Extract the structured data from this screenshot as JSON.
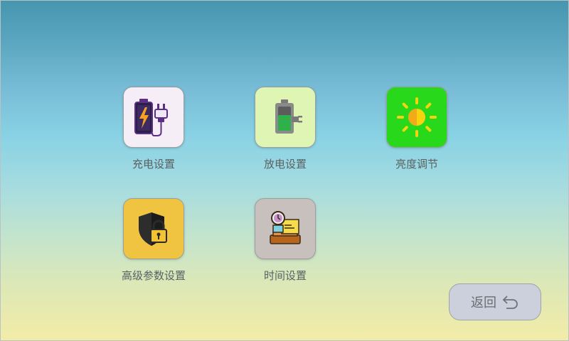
{
  "menu": {
    "items": [
      {
        "label": "充电设置",
        "icon": "battery-charging-plug-icon",
        "color": "#f5eef7"
      },
      {
        "label": "放电设置",
        "icon": "battery-plug-icon",
        "color": "#dff5b3"
      },
      {
        "label": "亮度调节",
        "icon": "sun-icon",
        "color": "#27d81b"
      },
      {
        "label": "高级参数设置",
        "icon": "shield-lock-icon",
        "color": "#f0c341"
      },
      {
        "label": "时间设置",
        "icon": "clock-box-icon",
        "color": "#c8c0bd"
      }
    ]
  },
  "back": {
    "label": "返回",
    "icon": "return-arrow-icon"
  }
}
